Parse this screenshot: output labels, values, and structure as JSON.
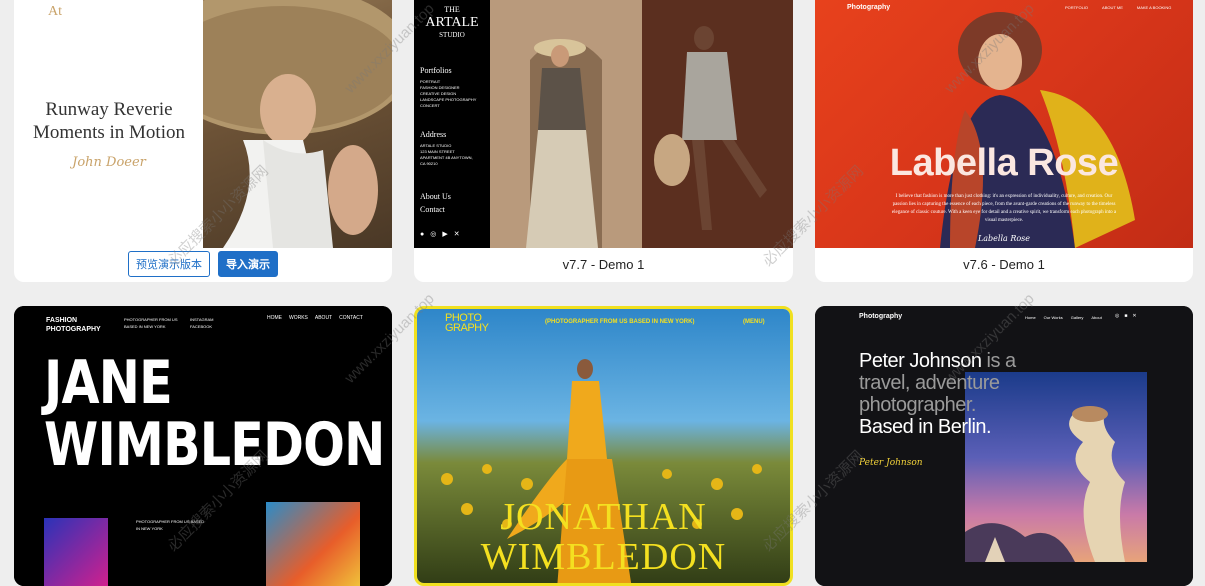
{
  "cards": [
    {
      "logo": "At",
      "title_line1": "Runway Reverie",
      "title_line2": "Moments in Motion",
      "signature": "John Doeer",
      "btn_preview": "预览演示版本",
      "btn_import": "导入演示"
    },
    {
      "brand_line1": "THE",
      "brand_line2": "ARTALE",
      "brand_line3": "STUDIO",
      "section1": "Portfolios",
      "items": [
        "PORTRAIT",
        "FASHION DESIGNER",
        "CREATIVE DESIGN",
        "LANDSCAPE PHOTOGRAPHY",
        "CONCERT"
      ],
      "section2": "Address",
      "address": [
        "ARTALE STUDIO",
        "123 MAIN STREET",
        "APARTMENT 4B ANYTOWN,",
        "CA 90210"
      ],
      "about": "About Us",
      "contact": "Contact",
      "caption": "v7.7 - Demo 1"
    },
    {
      "nav_brand": "Photography",
      "nav": [
        "PORTFOLIO",
        "ABOUT ME",
        "MAKE A BOOKING"
      ],
      "name": "Labella Rose",
      "blurb": "I believe that fashion is more than just clothing: it's an expression of individuality, culture, and creation. Our passion lies in capturing the essence of each piece, from the avant-garde creations of the runway to the timeless elegance of classic couture. With a keen eye for detail and a creative spirit, we transform each photograph into a visual masterpiece.",
      "signature": "Labella Rose",
      "caption": "v7.6 - Demo 1"
    },
    {
      "brand_line1": "FASHION",
      "brand_line2": "PHOTOGRAPHY",
      "header_col1a": "PHOTOGRAPHER FROM US",
      "header_col1b": "BASED IN NEW YORK",
      "header_col2a": "INSTAGRAM",
      "header_col2b": "FACEBOOK",
      "nav": [
        "HOME",
        "WORKS",
        "ABOUT",
        "CONTACT"
      ],
      "name_line1": "JANE",
      "name_line2": "WIMBLEDON",
      "footnote_a": "PHOTOGRAPHER FROM US BASED",
      "footnote_b": "IN NEW YORK"
    },
    {
      "logo_line1": "PHOTO",
      "logo_line2": "GRAPHY",
      "tagline": "(PHOTOGRAPHER FROM US BASED IN NEW YORK)",
      "menu": "(MENU)",
      "name_line1": "JONATHAN",
      "name_line2": "WIMBLEDON"
    },
    {
      "nav_brand": "Photography",
      "nav": [
        "Home",
        "Our Works",
        "Gallery",
        "About"
      ],
      "headline_name": "Peter Johnson",
      "headline_rest1": " is a",
      "headline_line2": "travel, adventure",
      "headline_line3": "photographer.",
      "headline_line4": "Based in Berlin.",
      "signature": "Peter Johnson"
    }
  ],
  "watermark_url": "www.xxziyuan.top",
  "watermark_cn": "必应搜索小小资源网"
}
